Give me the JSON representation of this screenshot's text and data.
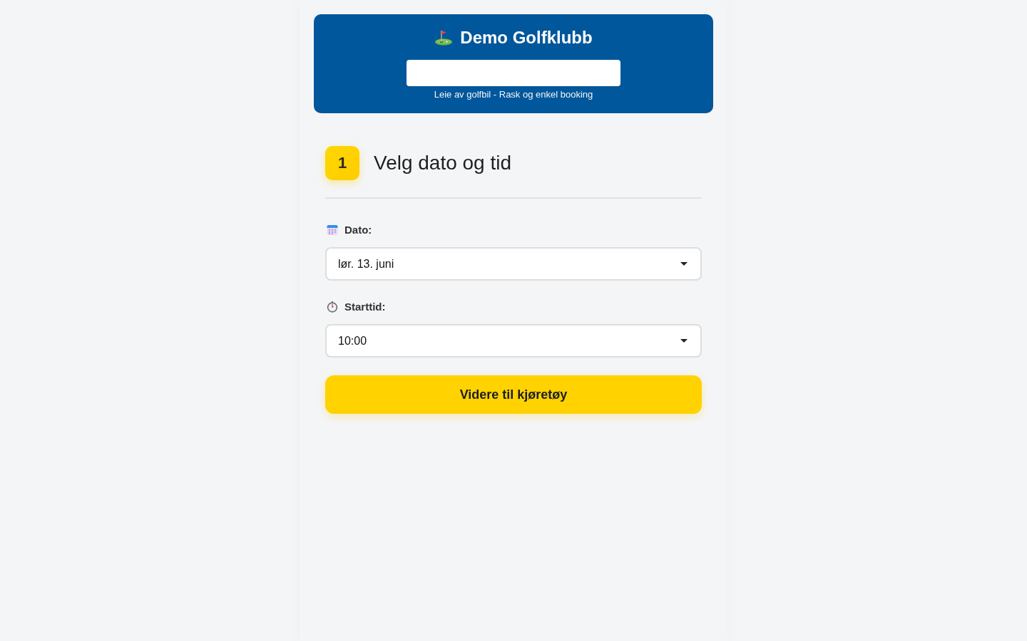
{
  "header": {
    "title": "Demo Golfklubb",
    "subtitle": "Leie av golfbil - Rask og enkel booking"
  },
  "step": {
    "number": "1",
    "title": "Velg dato og tid"
  },
  "fields": [
    {
      "kind": "date",
      "label": "Dato:",
      "value": "lør. 13. juni"
    },
    {
      "kind": "time",
      "label": "Starttid:",
      "value": "10:00"
    }
  ],
  "button": {
    "label": "Videre til kjøretøy"
  }
}
